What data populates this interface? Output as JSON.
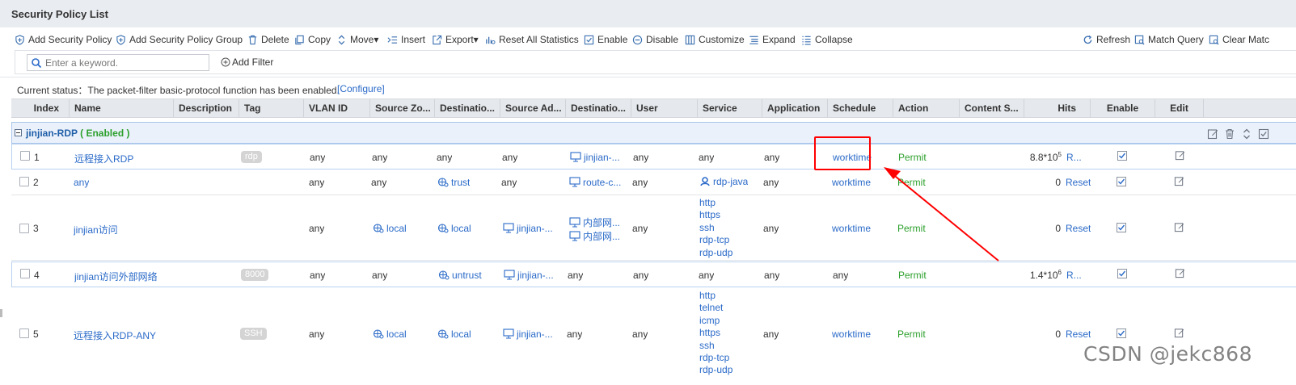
{
  "page_title": "Security Policy List",
  "toolbar": {
    "left": [
      {
        "label": "Add Security Policy",
        "icon": "shield-plus-icon"
      },
      {
        "label": "Add Security Policy Group",
        "icon": "shield-group-icon"
      },
      {
        "label": "Delete",
        "icon": "trash-icon"
      },
      {
        "label": "Copy",
        "icon": "copy-icon"
      },
      {
        "label": "Move▾",
        "icon": "move-icon"
      },
      {
        "label": "Insert",
        "icon": "insert-icon"
      },
      {
        "label": "Export▾",
        "icon": "export-icon"
      },
      {
        "label": "Reset All Statistics",
        "icon": "reset-stats-icon"
      },
      {
        "label": "Enable",
        "icon": "check-box-icon"
      },
      {
        "label": "Disable",
        "icon": "minus-circle-icon"
      },
      {
        "label": "Customize",
        "icon": "columns-icon"
      },
      {
        "label": "Expand",
        "icon": "expand-icon"
      },
      {
        "label": "Collapse",
        "icon": "collapse-icon"
      }
    ],
    "right": [
      {
        "label": "Refresh",
        "icon": "refresh-icon"
      },
      {
        "label": "Match Query",
        "icon": "match-query-icon"
      },
      {
        "label": "Clear Matc",
        "icon": "clear-match-icon"
      }
    ]
  },
  "search": {
    "placeholder": "Enter a keyword.",
    "value": ""
  },
  "add_filter": "Add Filter",
  "status": {
    "text": "Current status：The packet-filter basic-protocol function has been enabled.",
    "link": "[Configure]"
  },
  "columns": [
    "Index",
    "Name",
    "Description",
    "Tag",
    "VLAN ID",
    "Source Zo...",
    "Destinatio...",
    "Source Ad...",
    "Destinatio...",
    "User",
    "Service",
    "Application",
    "Schedule",
    "Action",
    "Content S...",
    "Hits",
    "Enable",
    "Edit"
  ],
  "group": {
    "name": "jinjian-RDP",
    "status": "( Enabled )"
  },
  "rows": [
    {
      "index": "1",
      "name": "远程接入RDP",
      "tag": "rdp",
      "vlan": "any",
      "src_zone": "any",
      "dst_zone": "any",
      "src_addr": "any",
      "dst_addr": [
        "jinjian-..."
      ],
      "user": "any",
      "service": [
        "any"
      ],
      "application": "any",
      "schedule": "worktime",
      "action": "Permit",
      "hits_base": "8.8*10",
      "hits_exp": "5",
      "reset": "R..."
    },
    {
      "index": "2",
      "name": "any",
      "tag": "",
      "vlan": "any",
      "src_zone": "any",
      "dst_zone": "trust",
      "src_addr": "any",
      "dst_addr": [
        "route-c..."
      ],
      "user": "any",
      "service": [
        "rdp-java"
      ],
      "application": "any",
      "schedule": "worktime",
      "action": "Permit",
      "hits_base": "0",
      "hits_exp": "",
      "reset": "Reset"
    },
    {
      "index": "3",
      "name": "jinjian访问",
      "tag": "",
      "vlan": "any",
      "src_zone": "local",
      "dst_zone": "local",
      "src_addr": "jinjian-...",
      "dst_addr": [
        "内部网...",
        "内部网..."
      ],
      "user": "any",
      "service": [
        "http",
        "https",
        "ssh",
        "rdp-tcp",
        "rdp-udp"
      ],
      "application": "any",
      "schedule": "worktime",
      "action": "Permit",
      "hits_base": "0",
      "hits_exp": "",
      "reset": "Reset"
    },
    {
      "index": "4",
      "name": "jinjian访问外部网络",
      "tag": "8000",
      "vlan": "any",
      "src_zone": "any",
      "dst_zone": "untrust",
      "src_addr": "jinjian-...",
      "dst_addr": [
        "any"
      ],
      "user": "any",
      "service": [
        "any"
      ],
      "application": "any",
      "schedule": "any",
      "action": "Permit",
      "hits_base": "1.4*10",
      "hits_exp": "6",
      "reset": "R..."
    },
    {
      "index": "5",
      "name": "远程接入RDP-ANY",
      "tag": "SSH",
      "vlan": "any",
      "src_zone": "local",
      "dst_zone": "local",
      "src_addr": "jinjian-...",
      "dst_addr": [
        "any"
      ],
      "user": "any",
      "service": [
        "http",
        "telnet",
        "icmp",
        "https",
        "ssh",
        "rdp-tcp",
        "rdp-udp"
      ],
      "application": "any",
      "schedule": "worktime",
      "action": "Permit",
      "hits_base": "0",
      "hits_exp": "",
      "reset": "Reset"
    }
  ],
  "watermark": "CSDN @jekc868",
  "colors": {
    "link": "#2a6ac8",
    "permit": "#2ca02c",
    "annotation": "#ff0000",
    "header_bg": "#e5e8ec",
    "group_bg": "#eaf1fb"
  }
}
